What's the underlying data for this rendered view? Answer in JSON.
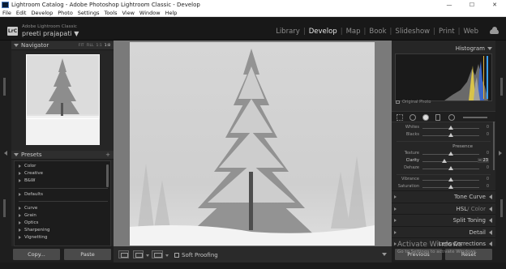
{
  "window": {
    "title": "Lightroom Catalog - Adobe Photoshop Lightroom Classic - Develop",
    "controls": [
      "—",
      "☐",
      "✕"
    ]
  },
  "menu": [
    "File",
    "Edit",
    "Develop",
    "Photo",
    "Settings",
    "Tools",
    "View",
    "Window",
    "Help"
  ],
  "identity": {
    "logo": "LrC",
    "app_name": "Adobe Lightroom Classic",
    "user": "preeti prajapati ▼"
  },
  "modules": [
    {
      "label": "Library",
      "active": false
    },
    {
      "label": "Develop",
      "active": true
    },
    {
      "label": "Map",
      "active": false
    },
    {
      "label": "Book",
      "active": false
    },
    {
      "label": "Slideshow",
      "active": false
    },
    {
      "label": "Print",
      "active": false
    },
    {
      "label": "Web",
      "active": false
    }
  ],
  "navigator": {
    "title": "Navigator",
    "zoom_options": [
      "FIT",
      "FILL",
      "1:1",
      "1:8"
    ],
    "selected_zoom": "1:8"
  },
  "presets": {
    "title": "Presets",
    "add": "+",
    "items": [
      "Color",
      "Creative",
      "B&W",
      "Defaults",
      "Curve",
      "Grain",
      "Optics",
      "Sharpening",
      "Vignetting"
    ]
  },
  "left_buttons": {
    "copy": "Copy...",
    "paste": "Paste"
  },
  "toolbar": {
    "soft_proofing": "Soft Proofing"
  },
  "histogram": {
    "title": "Histogram",
    "original_photo": "Original Photo"
  },
  "basic": {
    "top_sliders": [
      {
        "label": "Whites",
        "value": "0",
        "level": 0.5
      },
      {
        "label": "Blacks",
        "value": "0",
        "level": 0.5
      }
    ],
    "presence_label": "Presence",
    "presence_sliders": [
      {
        "label": "Texture",
        "value": "0",
        "level": 0.5
      },
      {
        "label": "Clarity",
        "value": "− 23",
        "level": 0.38
      },
      {
        "label": "Dehaze",
        "value": "0",
        "level": 0.5
      }
    ],
    "color_sliders": [
      {
        "label": "Vibrance",
        "value": "0",
        "level": 0.5
      },
      {
        "label": "Saturation",
        "value": "0",
        "level": 0.5
      }
    ]
  },
  "sections": [
    {
      "label": "Tone Curve",
      "extra": ""
    },
    {
      "label": "HSL",
      "extra": " / Color"
    },
    {
      "label": "Split Toning",
      "extra": ""
    },
    {
      "label": "Detail",
      "extra": ""
    },
    {
      "label": "Lens Corrections",
      "extra": ""
    }
  ],
  "right_buttons": {
    "previous": "Previous",
    "reset": "Reset"
  },
  "watermark": {
    "title": "Activate Windows",
    "subtitle": "Go to Settings to activate Windows."
  }
}
